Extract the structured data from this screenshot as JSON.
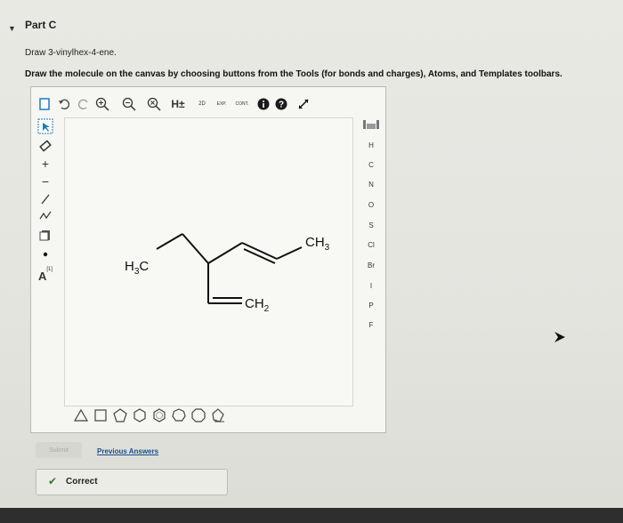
{
  "part": {
    "title": "Part C"
  },
  "prompt": "Draw 3-vinylhex-4-ene.",
  "instruction": "Draw the molecule on the canvas by choosing buttons from the Tools (for bonds and charges), Atoms, and Templates toolbars.",
  "toolbar": {
    "hydrogen_label": "H±",
    "twod_label": "2D",
    "exp_label": "EXP.",
    "cont_label": "CONT."
  },
  "left_tools": {
    "charge_plus": "+",
    "charge_minus": "−",
    "atom_label_tool": "A",
    "atom_label_sup": "[1]"
  },
  "atoms": [
    "H",
    "C",
    "N",
    "O",
    "S",
    "Cl",
    "Br",
    "I",
    "P",
    "F"
  ],
  "molecule": {
    "h3c": {
      "main": "H",
      "sub": "3",
      "tail": "C"
    },
    "ch3": {
      "main": "CH",
      "sub": "3"
    },
    "ch2": {
      "main": "CH",
      "sub": "2"
    }
  },
  "actions": {
    "submit_label": "Submit",
    "previous_answers_label": "Previous Answers"
  },
  "feedback": {
    "label": "Correct",
    "color": "#2f7a2f"
  },
  "colors": {
    "info": "#1a1a1a",
    "link": "#1a4f8a",
    "accent_arrow": "#111"
  }
}
